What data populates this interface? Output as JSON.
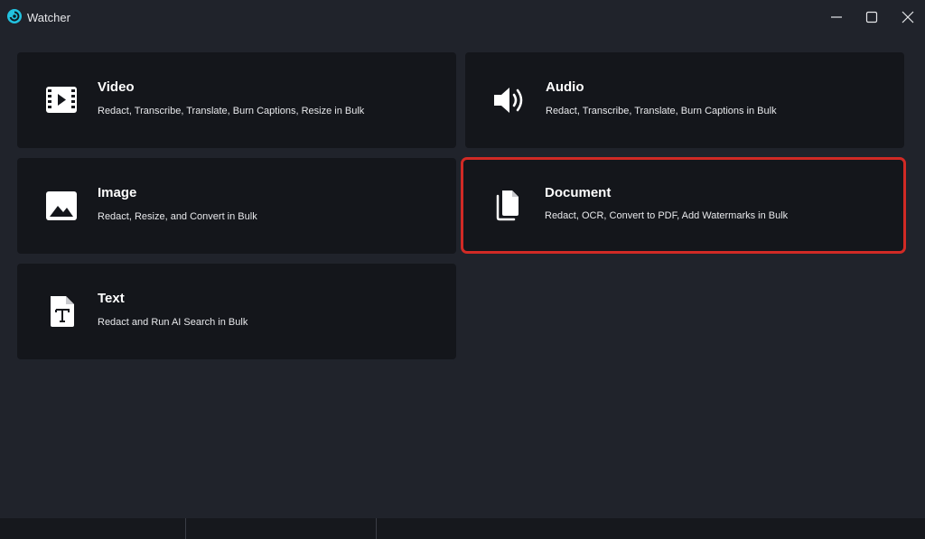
{
  "window": {
    "title": "Watcher",
    "accent_color": "#22c2e0",
    "selection_color": "#d12a25"
  },
  "cards": {
    "video": {
      "title": "Video",
      "description": "Redact, Transcribe, Translate, Burn Captions, Resize in Bulk",
      "icon": "video-film-icon"
    },
    "audio": {
      "title": "Audio",
      "description": "Redact, Transcribe, Translate, Burn Captions in Bulk",
      "icon": "speaker-icon"
    },
    "image": {
      "title": "Image",
      "description": "Redact, Resize, and Convert in Bulk",
      "icon": "image-icon"
    },
    "document": {
      "title": "Document",
      "description": "Redact, OCR, Convert to PDF, Add Watermarks in Bulk",
      "icon": "document-copy-icon",
      "selected": true
    },
    "text": {
      "title": "Text",
      "description": "Redact and Run AI Search in Bulk",
      "icon": "text-file-icon"
    }
  }
}
